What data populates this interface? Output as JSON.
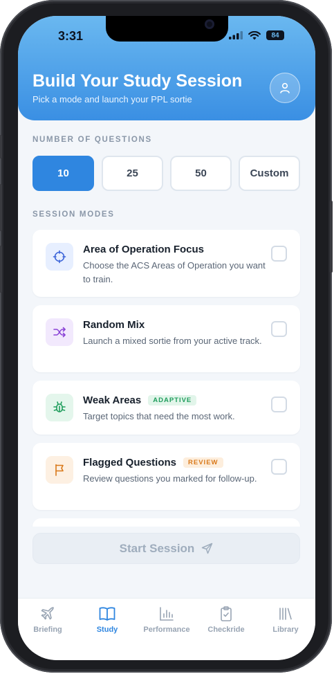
{
  "status_bar": {
    "time": "3:31",
    "battery": "84"
  },
  "header": {
    "title": "Build Your Study Session",
    "subtitle": "Pick a mode and launch your PPL sortie"
  },
  "questions_section": {
    "label": "NUMBER OF QUESTIONS",
    "options": [
      "10",
      "25",
      "50",
      "Custom"
    ],
    "selected": "10"
  },
  "modes_section": {
    "label": "SESSION MODES",
    "modes": [
      {
        "title": "Area of Operation Focus",
        "description": "Choose the ACS Areas of Operation you want to train.",
        "badge": "",
        "icon": "crosshair-icon",
        "checked": false
      },
      {
        "title": "Random Mix",
        "description": "Launch a mixed sortie from your active track.",
        "badge": "",
        "icon": "shuffle-icon",
        "checked": false
      },
      {
        "title": "Weak Areas",
        "description": "Target topics that need the most work.",
        "badge": "ADAPTIVE",
        "icon": "bug-icon",
        "checked": false
      },
      {
        "title": "Flagged Questions",
        "description": "Review questions you marked for follow-up.",
        "badge": "REVIEW",
        "icon": "flag-icon",
        "checked": false
      }
    ]
  },
  "start_button": {
    "label": "Start Session",
    "enabled": false
  },
  "tab_bar": {
    "active": "Study",
    "tabs": [
      "Briefing",
      "Study",
      "Performance",
      "Checkride",
      "Library"
    ]
  },
  "colors": {
    "accent": "#2f86e0",
    "header_gradient_top": "#6ab8f0",
    "header_gradient_bottom": "#3a8fe3",
    "adaptive_badge": "#1f9d5c",
    "review_badge": "#d9791a"
  }
}
